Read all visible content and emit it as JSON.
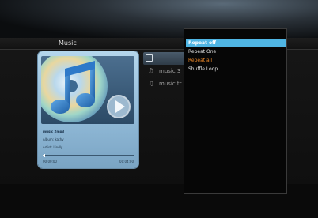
{
  "title": "Music",
  "now_playing": {
    "lines": [
      "music 2mp3",
      "Album: kathy",
      "Artist: Lindly"
    ],
    "progress": 0.02,
    "elapsed": "00:00:00",
    "total": "00:04:00"
  },
  "file_list": [
    {
      "label": "",
      "icon": "folder-icon",
      "selected": true
    },
    {
      "label": "music 3",
      "icon": "note-icon",
      "selected": false
    },
    {
      "label": "music tr",
      "icon": "note-icon",
      "selected": false
    }
  ],
  "repeat_menu": [
    {
      "label": "Repeat off",
      "state": "selected"
    },
    {
      "label": "Repeat One",
      "state": "normal"
    },
    {
      "label": "Repeat all",
      "state": "active"
    },
    {
      "label": "Shuffle Loop",
      "state": "normal"
    }
  ],
  "colors": {
    "menu_highlight": "#4fb5e3",
    "active_option": "#f08a2a",
    "panel_blue": "#9ec5e2"
  }
}
